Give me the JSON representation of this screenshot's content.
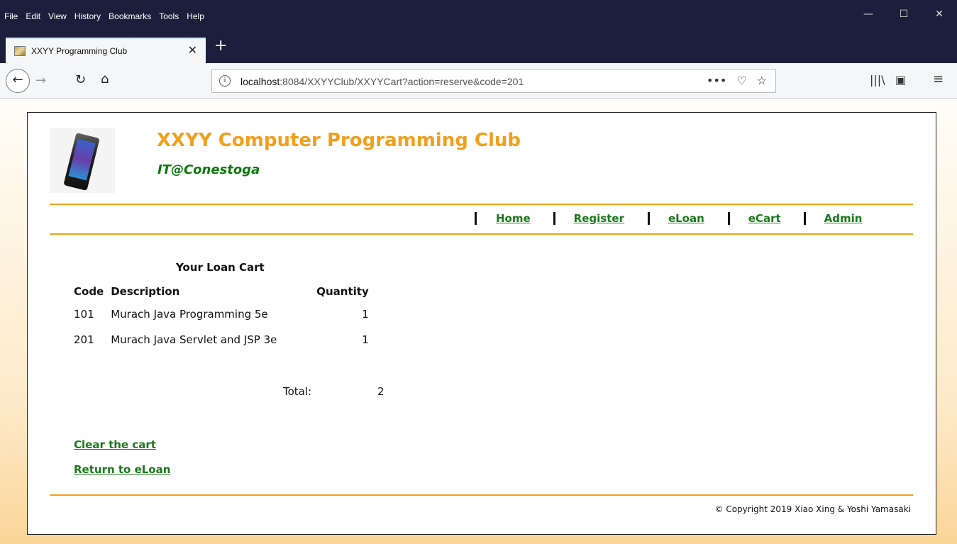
{
  "menubar": {
    "items": [
      "File",
      "Edit",
      "View",
      "History",
      "Bookmarks",
      "Tools",
      "Help"
    ],
    "window_controls": {
      "minimize": "—",
      "maximize": "☐",
      "close": "✕"
    }
  },
  "tab": {
    "title": "XXYY Programming Club",
    "close": "✕",
    "new_tab": "+"
  },
  "navbar": {
    "url_host": "localhost",
    "url_rest": ":8084/XXYYClub/XXYYCart?action=reserve&code=201",
    "icons": [
      "back-icon",
      "forward-icon",
      "reload-icon",
      "home-icon",
      "info-icon",
      "page-actions-icon",
      "pocket-icon",
      "bookmark-star-icon",
      "library-icon",
      "sidebar-icon",
      "menu-icon"
    ]
  },
  "site": {
    "title": "XXYY Computer Programming Club",
    "subtitle": "IT@Conestoga",
    "nav": [
      {
        "label": "Home"
      },
      {
        "label": "Register"
      },
      {
        "label": "eLoan"
      },
      {
        "label": "eCart"
      },
      {
        "label": "Admin"
      }
    ]
  },
  "cart": {
    "title": "Your Loan Cart",
    "headers": {
      "code": "Code",
      "description": "Description",
      "quantity": "Quantity"
    },
    "rows": [
      {
        "code": "101",
        "description": "Murach Java Programming 5e",
        "quantity": "1"
      },
      {
        "code": "201",
        "description": "Murach Java Servlet and JSP 3e",
        "quantity": "1"
      }
    ],
    "total_label": "Total:",
    "total_value": "2",
    "clear_link": "Clear the cart",
    "return_link": "Return to eLoan"
  },
  "footer": {
    "copyright": "© Copyright 2019 Xiao Xing & Yoshi Yamasaki"
  },
  "colors": {
    "title_orange": "#f0a01c",
    "link_green": "#1a7a1a",
    "subtitle_green": "#0b7a0b",
    "chrome_dark": "#1c1f3b"
  }
}
